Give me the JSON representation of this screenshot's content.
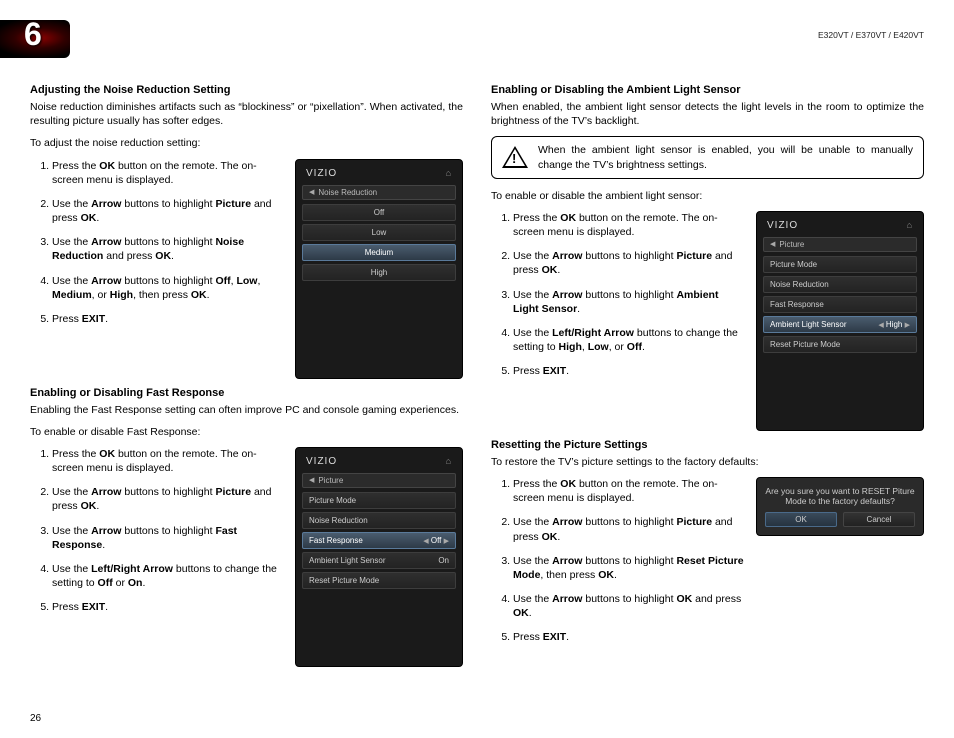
{
  "header": {
    "chapter": "6",
    "models": "E320VT / E370VT / E420VT"
  },
  "page_number": "26",
  "left": {
    "nr": {
      "title": "Adjusting the Noise Reduction Setting",
      "intro": "Noise reduction diminishes artifacts such as “blockiness” or “pixellation”. When activated, the resulting picture usually has softer edges.",
      "lead": "To adjust the noise reduction setting:",
      "s1a": "Press the ",
      "s1b": "OK",
      "s1c": " button on the remote. The on-screen menu is displayed.",
      "s2a": "Use the ",
      "s2b": "Arrow",
      "s2c": " buttons to highlight ",
      "s2d": "Picture",
      "s2e": " and press ",
      "s2f": "OK",
      "s2g": ".",
      "s3a": "Use the ",
      "s3b": "Arrow",
      "s3c": " buttons to highlight ",
      "s3d": "Noise Reduction",
      "s3e": " and press ",
      "s3f": "OK",
      "s3g": ".",
      "s4a": "Use the ",
      "s4b": "Arrow",
      "s4c": " buttons to highlight ",
      "s4d": "Off",
      "s4e": ", ",
      "s4f": "Low",
      "s4g": ", ",
      "s4h": "Medium",
      "s4i": ", or ",
      "s4j": "High",
      "s4k": ", then press ",
      "s4l": "OK",
      "s4m": ".",
      "s5a": "Press ",
      "s5b": "EXIT",
      "s5c": "."
    },
    "fr": {
      "title": "Enabling or Disabling Fast Response",
      "intro": "Enabling the Fast Response setting can often improve PC and console gaming experiences.",
      "lead": "To enable or disable Fast Response:",
      "s1a": "Press the ",
      "s1b": "OK",
      "s1c": " button on the remote. The on-screen menu is displayed.",
      "s2a": "Use the ",
      "s2b": "Arrow",
      "s2c": " buttons to highlight ",
      "s2d": "Picture",
      "s2e": " and press ",
      "s2f": "OK",
      "s2g": ".",
      "s3a": "Use the ",
      "s3b": "Arrow",
      "s3c": " buttons to highlight ",
      "s3d": "Fast Response",
      "s3e": ".",
      "s4a": "Use the ",
      "s4b": "Left/Right Arrow",
      "s4c": " buttons to change the setting to ",
      "s4d": "Off",
      "s4e": " or ",
      "s4f": "On",
      "s4g": ".",
      "s5a": "Press ",
      "s5b": "EXIT",
      "s5c": "."
    }
  },
  "right": {
    "als": {
      "title": "Enabling or Disabling the Ambient Light Sensor",
      "intro": "When enabled, the ambient light sensor detects the light levels in the room to optimize the brightness of the TV’s backlight.",
      "warn": "When the ambient light sensor is enabled, you will be unable to manually change the TV’s brightness settings.",
      "lead": "To enable or disable the ambient light sensor:",
      "s1a": "Press the ",
      "s1b": "OK",
      "s1c": " button on the remote. The on-screen menu is displayed.",
      "s2a": "Use the ",
      "s2b": "Arrow",
      "s2c": " buttons to highlight ",
      "s2d": "Picture",
      "s2e": " and press ",
      "s2f": "OK",
      "s2g": ".",
      "s3a": "Use the ",
      "s3b": "Arrow",
      "s3c": " buttons to highlight ",
      "s3d": "Ambient Light Sensor",
      "s3e": ".",
      "s4a": "Use the ",
      "s4b": "Left/Right Arrow",
      "s4c": " buttons to change the setting to ",
      "s4d": "High",
      "s4e": ", ",
      "s4f": "Low",
      "s4g": ", or ",
      "s4h": "Off",
      "s4i": ".",
      "s5a": "Press ",
      "s5b": "EXIT",
      "s5c": "."
    },
    "rst": {
      "title": "Resetting the Picture Settings",
      "lead": "To restore the TV’s picture settings to the factory defaults:",
      "s1a": "Press the ",
      "s1b": "OK",
      "s1c": " button on the remote. The on-screen menu is displayed.",
      "s2a": "Use the ",
      "s2b": "Arrow",
      "s2c": " buttons to highlight ",
      "s2d": "Picture",
      "s2e": " and press ",
      "s2f": "OK",
      "s2g": ".",
      "s3a": "Use the ",
      "s3b": "Arrow",
      "s3c": " buttons to highlight ",
      "s3d": "Reset Picture Mode",
      "s3e": ", then press ",
      "s3f": "OK",
      "s3g": ".",
      "s4a": "Use the ",
      "s4b": "Arrow",
      "s4c": " buttons to highlight ",
      "s4d": "OK",
      "s4e": " and press ",
      "s4f": "OK",
      "s4g": ".",
      "s5a": "Press ",
      "s5b": "EXIT",
      "s5c": "."
    }
  },
  "tv": {
    "brand": "VIZIO",
    "menu_nr": {
      "crumb": "Noise Reduction",
      "opts": [
        "Off",
        "Low",
        "Medium",
        "High"
      ],
      "hl": 2
    },
    "menu_pic": {
      "crumb": "Picture",
      "rows": [
        {
          "l": "Picture Mode",
          "r": ""
        },
        {
          "l": "Noise Reduction",
          "r": ""
        },
        {
          "l": "Fast Response",
          "r": "Off",
          "hl": true,
          "arrows": true
        },
        {
          "l": "Ambient Light Sensor",
          "r": "On"
        },
        {
          "l": "Reset Picture Mode",
          "r": ""
        }
      ]
    },
    "menu_als": {
      "crumb": "Picture",
      "rows": [
        {
          "l": "Picture Mode",
          "r": ""
        },
        {
          "l": "Noise Reduction",
          "r": ""
        },
        {
          "l": "Fast Response",
          "r": ""
        },
        {
          "l": "Ambient Light Sensor",
          "r": "High",
          "hl": true,
          "arrows": true
        },
        {
          "l": "Reset Picture Mode",
          "r": ""
        }
      ]
    },
    "dialog": {
      "msg": "Are you sure you want to RESET Piture Mode to the factory defaults?",
      "ok": "OK",
      "cancel": "Cancel"
    }
  }
}
